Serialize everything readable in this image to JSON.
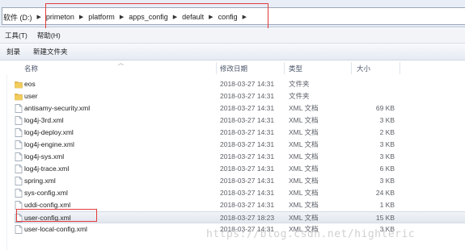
{
  "address": {
    "drive": "软件 (D:)",
    "crumbs": [
      "primeton",
      "platform",
      "apps_config",
      "default",
      "config"
    ]
  },
  "menu": [
    "工具(T)",
    "帮助(H)"
  ],
  "toolbar": [
    "刻录",
    "新建文件夹"
  ],
  "columns": {
    "name": "名称",
    "date": "修改日期",
    "type": "类型",
    "size": "大小"
  },
  "files": [
    {
      "name": "eos",
      "date": "2018-03-27 14:31",
      "type": "文件夹",
      "size": "",
      "icon": "folder-icon"
    },
    {
      "name": "user",
      "date": "2018-03-27 14:31",
      "type": "文件夹",
      "size": "",
      "icon": "folder-icon"
    },
    {
      "name": "antisamy-security.xml",
      "date": "2018-03-27 14:31",
      "type": "XML 文档",
      "size": "69 KB",
      "icon": "xml-file-icon"
    },
    {
      "name": "log4j-3rd.xml",
      "date": "2018-03-27 14:31",
      "type": "XML 文档",
      "size": "3 KB",
      "icon": "xml-file-icon"
    },
    {
      "name": "log4j-deploy.xml",
      "date": "2018-03-27 14:31",
      "type": "XML 文档",
      "size": "2 KB",
      "icon": "xml-file-icon"
    },
    {
      "name": "log4j-engine.xml",
      "date": "2018-03-27 14:31",
      "type": "XML 文档",
      "size": "3 KB",
      "icon": "xml-file-icon"
    },
    {
      "name": "log4j-sys.xml",
      "date": "2018-03-27 14:31",
      "type": "XML 文档",
      "size": "3 KB",
      "icon": "xml-file-icon"
    },
    {
      "name": "log4j-trace.xml",
      "date": "2018-03-27 14:31",
      "type": "XML 文档",
      "size": "6 KB",
      "icon": "xml-file-icon"
    },
    {
      "name": "spring.xml",
      "date": "2018-03-27 14:31",
      "type": "XML 文档",
      "size": "3 KB",
      "icon": "xml-file-icon"
    },
    {
      "name": "sys-config.xml",
      "date": "2018-03-27 14:31",
      "type": "XML 文档",
      "size": "24 KB",
      "icon": "xml-file-icon"
    },
    {
      "name": "uddi-config.xml",
      "date": "2018-03-27 14:31",
      "type": "XML 文档",
      "size": "1 KB",
      "icon": "xml-file-icon"
    },
    {
      "name": "user-config.xml",
      "date": "2018-03-27 18:23",
      "type": "XML 文档",
      "size": "15 KB",
      "icon": "xml-file-icon",
      "selected": true
    },
    {
      "name": "user-local-config.xml",
      "date": "2018-03-27 14:31",
      "type": "XML 文档",
      "size": "3 KB",
      "icon": "xml-file-icon"
    }
  ],
  "watermark": "https://blog.csdn.net/highteric",
  "colors": {
    "highlight_box": "#e23b3b",
    "folder": "#e8b93a"
  }
}
